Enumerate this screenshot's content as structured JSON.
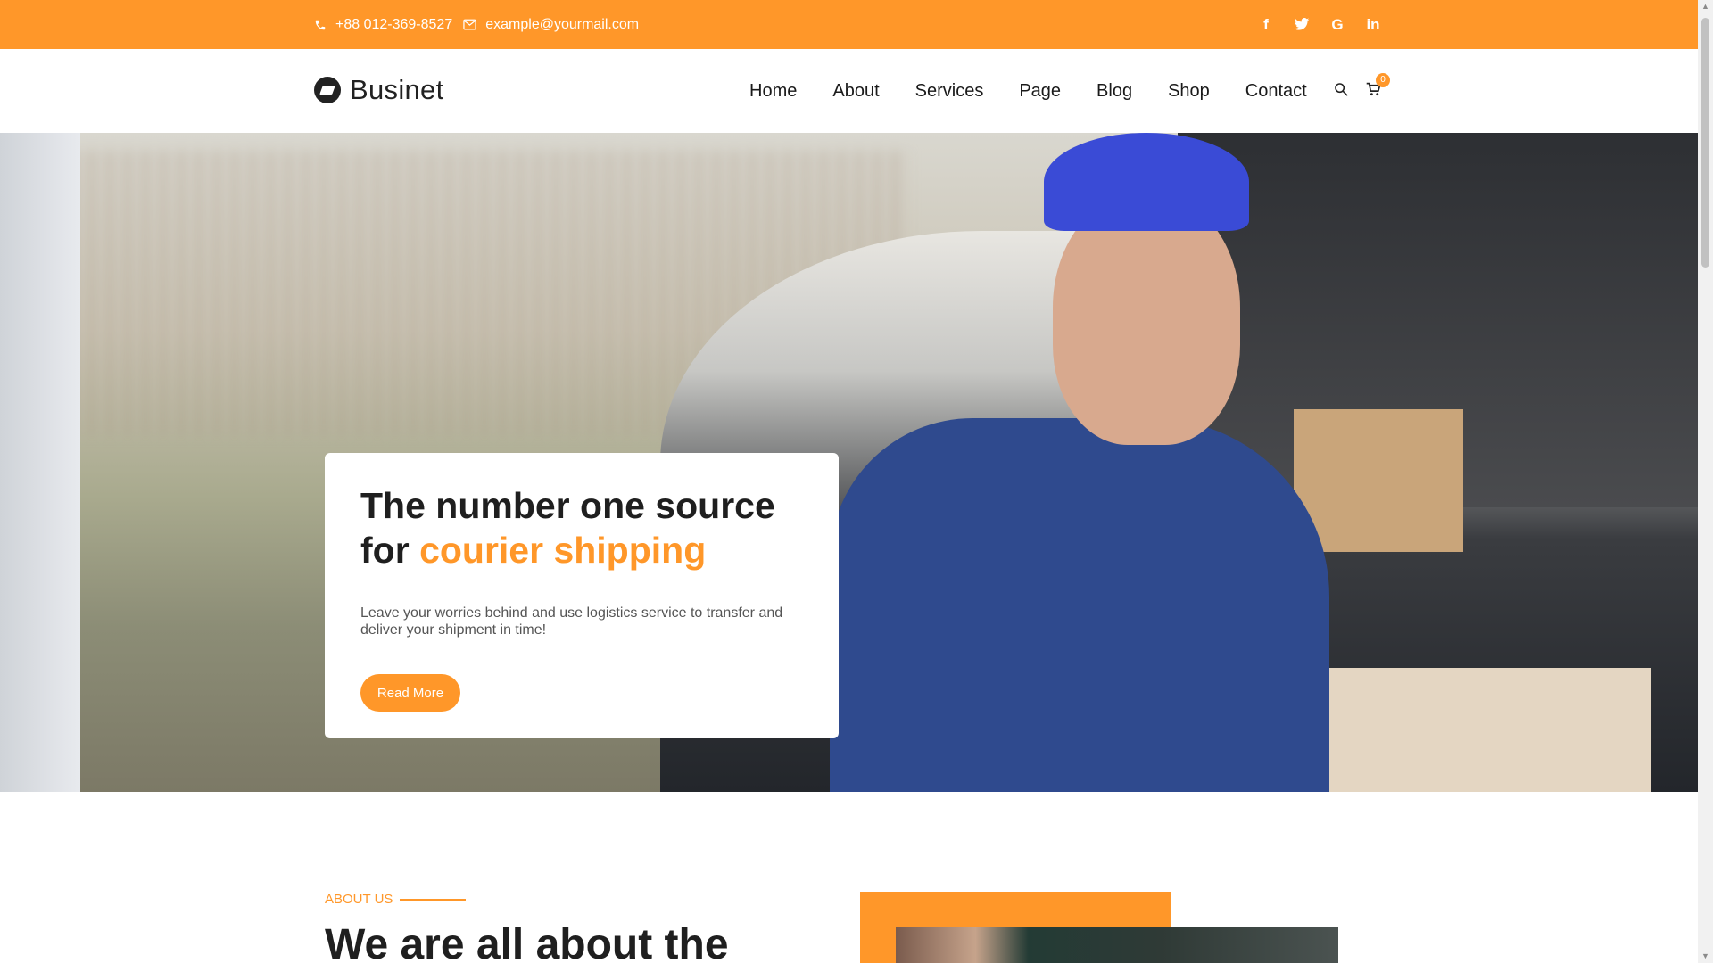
{
  "topbar": {
    "phone": "+88 012-369-8527",
    "email": "example@yourmail.com",
    "social": [
      {
        "icon": "facebook-icon",
        "glyph": "f"
      },
      {
        "icon": "twitter-icon",
        "glyph": "t"
      },
      {
        "icon": "google-icon",
        "glyph": "G"
      },
      {
        "icon": "linkedin-icon",
        "glyph": "in"
      }
    ]
  },
  "header": {
    "logo": "Businet",
    "nav": [
      "Home",
      "About",
      "Services",
      "Page",
      "Blog",
      "Shop",
      "Contact"
    ],
    "cart_count": "0"
  },
  "hero": {
    "title_line1": "The number one source",
    "title_for": "for",
    "title_accent": "courier shipping",
    "description": "Leave your worries behind and use logistics service to transfer and deliver your shipment in time!",
    "button": "Read More"
  },
  "about": {
    "label": "ABOUT US",
    "title": "We are all about the"
  },
  "colors": {
    "accent": "#ff9729",
    "text": "#1f1f1f"
  }
}
